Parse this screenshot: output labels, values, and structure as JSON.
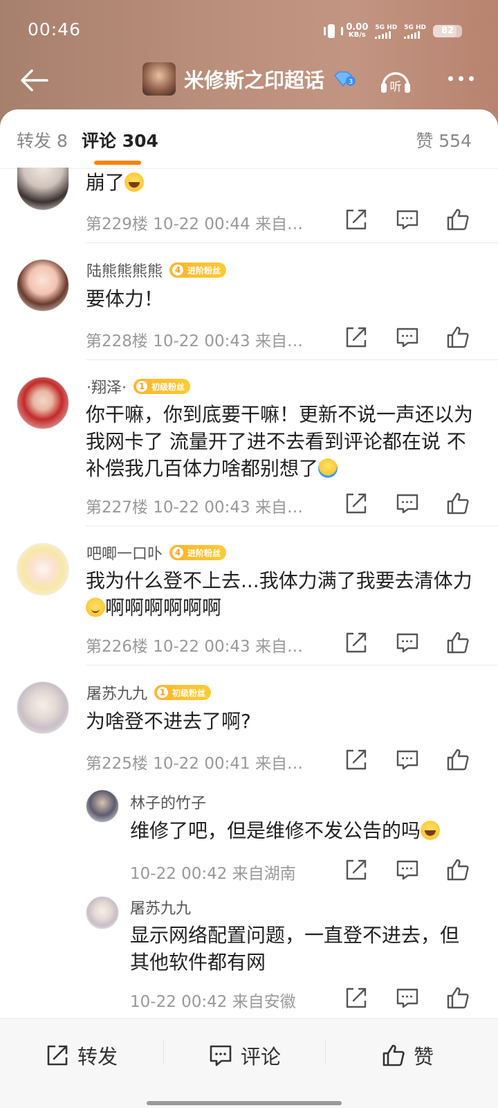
{
  "status_bar": {
    "time": "00:46",
    "speed_value": "0.00",
    "speed_unit": "KB/s",
    "sim1": "5G HD",
    "sim2": "5G HD",
    "battery": "82",
    "battery_level": 0.82
  },
  "header": {
    "title": "米修斯之印超话",
    "diamond_level": "3",
    "listen_label": "听"
  },
  "tabs": {
    "repost": "转发 8",
    "comments": "评论 304",
    "likes": "赞 554"
  },
  "comments": [
    {
      "user": "",
      "text": "崩了",
      "emoji": "laugh-cry",
      "meta": "第229楼 10-22 00:44 来自…"
    },
    {
      "user": "陆熊熊熊熊",
      "badge_level": "4",
      "badge_text": "进阶粉丝",
      "text": "要体力！",
      "meta": "第228楼 10-22 00:43 来自…"
    },
    {
      "user": "·翔泽·",
      "badge_level": "1",
      "badge_text": "初级粉丝",
      "text": "你干嘛，你到底要干嘛！更新不说一声还以为我网卡了 流量开了进不去看到评论都在说 不补偿我几百体力啥都别想了",
      "emoji": "shrug",
      "meta": "第227楼 10-22 00:43 来自…"
    },
    {
      "user": "吧唧一口卟",
      "badge_level": "4",
      "badge_text": "进阶粉丝",
      "text_part1": "我为什么登不上去...我体力满了我要去清体力",
      "emoji": "smile",
      "text_part2": "啊啊啊啊啊啊",
      "meta": "第226楼 10-22 00:43 来自…"
    },
    {
      "user": "屠苏九九",
      "badge_level": "1",
      "badge_text": "初级粉丝",
      "text": "为啥登不进去了啊?",
      "meta": "第225楼 10-22 00:41 来自…"
    }
  ],
  "replies": [
    {
      "user": "林子的竹子",
      "text": "维修了吧，但是维修不发公告的吗",
      "emoji": "laugh-cry",
      "meta": "10-22 00:42 来自湖南"
    },
    {
      "user": "屠苏九九",
      "text": "显示网络配置问题，一直登不进去，但其他软件都有网",
      "meta": "10-22 00:42 来自安徽"
    }
  ],
  "bottom_bar": {
    "repost": "转发",
    "comment": "评论",
    "like": "赞"
  },
  "colors": {
    "accent": "#ff8200",
    "badge": "#ffb52e",
    "meta": "#999999"
  }
}
